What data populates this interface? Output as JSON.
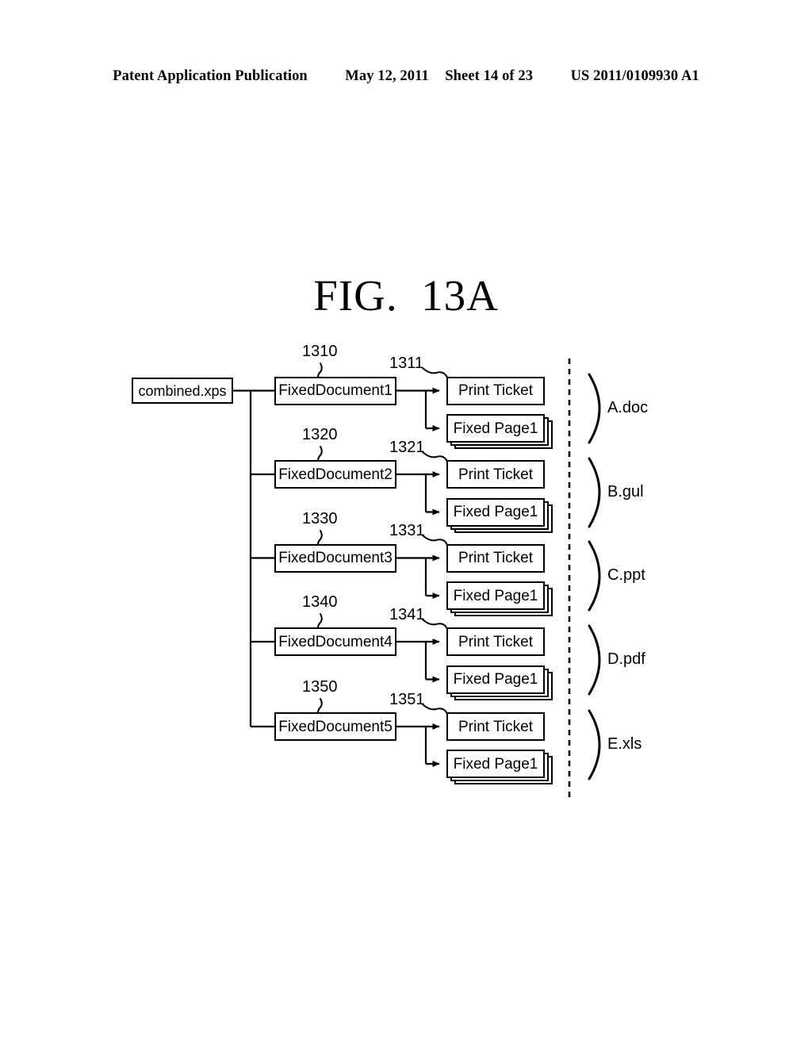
{
  "header": {
    "publication": "Patent Application Publication",
    "date": "May 12, 2011",
    "sheet": "Sheet 14 of 23",
    "patent_number": "US 2011/0109930 A1"
  },
  "figure": {
    "title": "FIG.  13A"
  },
  "diagram": {
    "root": {
      "label": "combined.xps",
      "name": "combined-xps-node"
    },
    "documents": [
      {
        "doc_label": "FixedDocument1",
        "doc_ref": "1310",
        "child_ref": "1311",
        "ticket_label": "Print Ticket",
        "page_label": "Fixed Page1",
        "file_label": "A.doc"
      },
      {
        "doc_label": "FixedDocument2",
        "doc_ref": "1320",
        "child_ref": "1321",
        "ticket_label": "Print Ticket",
        "page_label": "Fixed Page1",
        "file_label": "B.gul"
      },
      {
        "doc_label": "FixedDocument3",
        "doc_ref": "1330",
        "child_ref": "1331",
        "ticket_label": "Print Ticket",
        "page_label": "Fixed Page1",
        "file_label": "C.ppt"
      },
      {
        "doc_label": "FixedDocument4",
        "doc_ref": "1340",
        "child_ref": "1341",
        "ticket_label": "Print Ticket",
        "page_label": "Fixed Page1",
        "file_label": "D.pdf"
      },
      {
        "doc_label": "FixedDocument5",
        "doc_ref": "1350",
        "child_ref": "1351",
        "ticket_label": "Print Ticket",
        "page_label": "Fixed Page1",
        "file_label": "E.xls"
      }
    ]
  },
  "colors": {
    "ink": "#000000",
    "paper": "#ffffff"
  }
}
